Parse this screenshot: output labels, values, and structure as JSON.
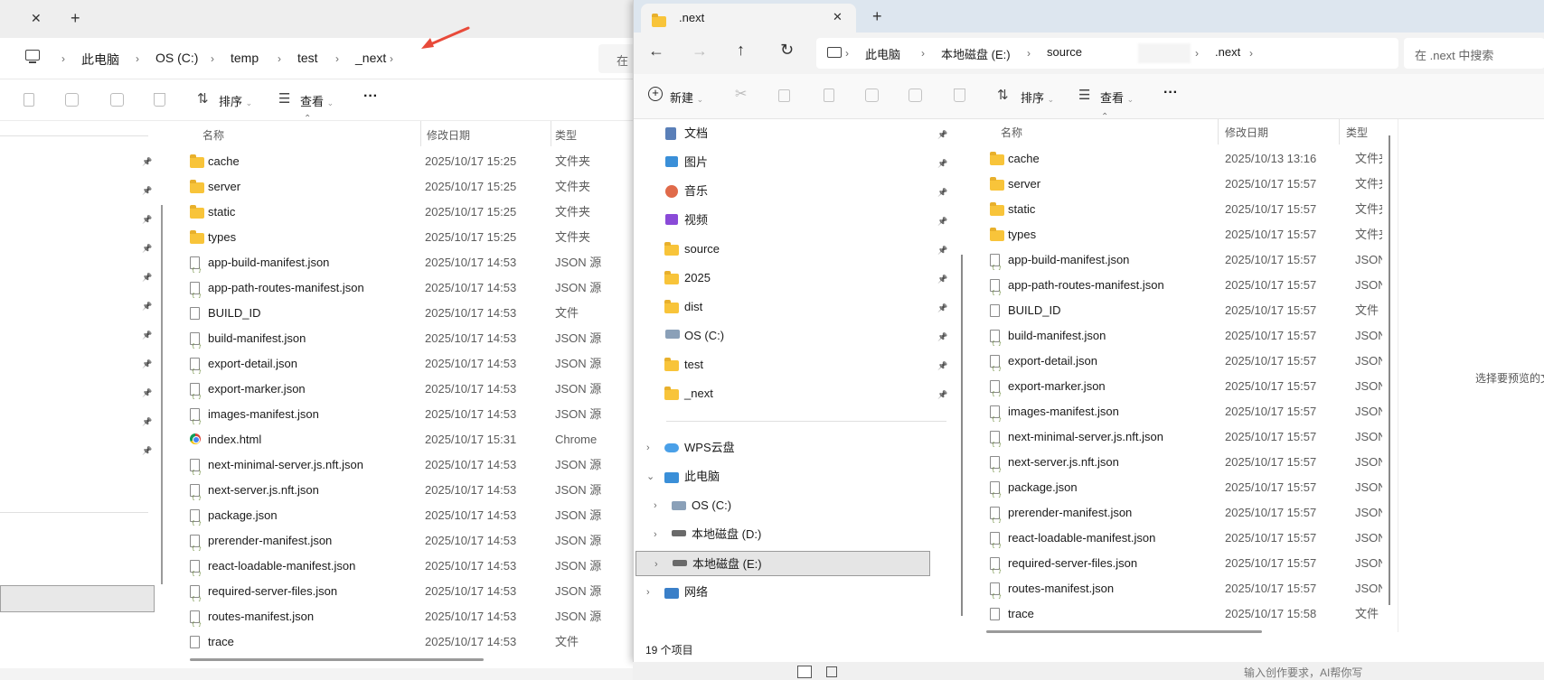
{
  "left_window": {
    "tab_close": "✕",
    "tab_new": "+",
    "breadcrumb": [
      "此电脑",
      "OS (C:)",
      "temp",
      "test",
      "_next"
    ],
    "search_partial": "在",
    "toolbar": {
      "sort": "排序",
      "view": "查看",
      "more": "···"
    },
    "headers": {
      "name": "名称",
      "date": "修改日期",
      "type": "类型"
    },
    "files": [
      {
        "name": "cache",
        "date": "2025/10/17 15:25",
        "type": "文件夹",
        "kind": "folder"
      },
      {
        "name": "server",
        "date": "2025/10/17 15:25",
        "type": "文件夹",
        "kind": "folder"
      },
      {
        "name": "static",
        "date": "2025/10/17 15:25",
        "type": "文件夹",
        "kind": "folder"
      },
      {
        "name": "types",
        "date": "2025/10/17 15:25",
        "type": "文件夹",
        "kind": "folder"
      },
      {
        "name": "app-build-manifest.json",
        "date": "2025/10/17 14:53",
        "type": "JSON 源",
        "kind": "json"
      },
      {
        "name": "app-path-routes-manifest.json",
        "date": "2025/10/17 14:53",
        "type": "JSON 源",
        "kind": "json"
      },
      {
        "name": "BUILD_ID",
        "date": "2025/10/17 14:53",
        "type": "文件",
        "kind": "file"
      },
      {
        "name": "build-manifest.json",
        "date": "2025/10/17 14:53",
        "type": "JSON 源",
        "kind": "json"
      },
      {
        "name": "export-detail.json",
        "date": "2025/10/17 14:53",
        "type": "JSON 源",
        "kind": "json"
      },
      {
        "name": "export-marker.json",
        "date": "2025/10/17 14:53",
        "type": "JSON 源",
        "kind": "json"
      },
      {
        "name": "images-manifest.json",
        "date": "2025/10/17 14:53",
        "type": "JSON 源",
        "kind": "json"
      },
      {
        "name": "index.html",
        "date": "2025/10/17 15:31",
        "type": "Chrome",
        "kind": "chrome"
      },
      {
        "name": "next-minimal-server.js.nft.json",
        "date": "2025/10/17 14:53",
        "type": "JSON 源",
        "kind": "json"
      },
      {
        "name": "next-server.js.nft.json",
        "date": "2025/10/17 14:53",
        "type": "JSON 源",
        "kind": "json"
      },
      {
        "name": "package.json",
        "date": "2025/10/17 14:53",
        "type": "JSON 源",
        "kind": "json"
      },
      {
        "name": "prerender-manifest.json",
        "date": "2025/10/17 14:53",
        "type": "JSON 源",
        "kind": "json"
      },
      {
        "name": "react-loadable-manifest.json",
        "date": "2025/10/17 14:53",
        "type": "JSON 源",
        "kind": "json"
      },
      {
        "name": "required-server-files.json",
        "date": "2025/10/17 14:53",
        "type": "JSON 源",
        "kind": "json"
      },
      {
        "name": "routes-manifest.json",
        "date": "2025/10/17 14:53",
        "type": "JSON 源",
        "kind": "json"
      },
      {
        "name": "trace",
        "date": "2025/10/17 14:53",
        "type": "文件",
        "kind": "file"
      }
    ]
  },
  "right_window": {
    "tab_title": ".next",
    "tab_close": "✕",
    "tab_new": "+",
    "breadcrumb": [
      "此电脑",
      "本地磁盘 (E:)",
      "source",
      ".next"
    ],
    "search_placeholder": "在 .next 中搜索",
    "toolbar": {
      "new": "新建",
      "sort": "排序",
      "view": "查看",
      "more": "···"
    },
    "quick_access": [
      {
        "label": "文档",
        "icon": "documents-icon"
      },
      {
        "label": "图片",
        "icon": "pictures-icon"
      },
      {
        "label": "音乐",
        "icon": "music-icon"
      },
      {
        "label": "视频",
        "icon": "video-icon"
      },
      {
        "label": "source",
        "icon": "folder-icon"
      },
      {
        "label": "2025",
        "icon": "folder-icon"
      },
      {
        "label": "dist",
        "icon": "folder-icon"
      },
      {
        "label": "OS (C:)",
        "icon": "os-drive-icon"
      },
      {
        "label": "test",
        "icon": "folder-icon"
      },
      {
        "label": "_next",
        "icon": "folder-icon"
      }
    ],
    "tree": [
      {
        "label": "WPS云盘",
        "icon": "cloud-icon",
        "indent": 0,
        "expanded": false
      },
      {
        "label": "此电脑",
        "icon": "pc-icon",
        "indent": 0,
        "expanded": true
      },
      {
        "label": "OS (C:)",
        "icon": "os-drive-icon",
        "indent": 1,
        "expanded": false
      },
      {
        "label": "本地磁盘 (D:)",
        "icon": "drive-icon",
        "indent": 1,
        "expanded": false
      },
      {
        "label": "本地磁盘 (E:)",
        "icon": "drive-icon",
        "indent": 1,
        "expanded": false,
        "selected": true
      },
      {
        "label": "网络",
        "icon": "network-icon",
        "indent": 0,
        "expanded": false
      }
    ],
    "headers": {
      "name": "名称",
      "date": "修改日期",
      "type": "类型"
    },
    "files": [
      {
        "name": "cache",
        "date": "2025/10/13 13:16",
        "type": "文件夹",
        "kind": "folder"
      },
      {
        "name": "server",
        "date": "2025/10/17 15:57",
        "type": "文件夹",
        "kind": "folder"
      },
      {
        "name": "static",
        "date": "2025/10/17 15:57",
        "type": "文件夹",
        "kind": "folder"
      },
      {
        "name": "types",
        "date": "2025/10/17 15:57",
        "type": "文件夹",
        "kind": "folder"
      },
      {
        "name": "app-build-manifest.json",
        "date": "2025/10/17 15:57",
        "type": "JSON",
        "kind": "json"
      },
      {
        "name": "app-path-routes-manifest.json",
        "date": "2025/10/17 15:57",
        "type": "JSON",
        "kind": "json"
      },
      {
        "name": "BUILD_ID",
        "date": "2025/10/17 15:57",
        "type": "文件",
        "kind": "file"
      },
      {
        "name": "build-manifest.json",
        "date": "2025/10/17 15:57",
        "type": "JSON",
        "kind": "json"
      },
      {
        "name": "export-detail.json",
        "date": "2025/10/17 15:57",
        "type": "JSON",
        "kind": "json"
      },
      {
        "name": "export-marker.json",
        "date": "2025/10/17 15:57",
        "type": "JSON",
        "kind": "json"
      },
      {
        "name": "images-manifest.json",
        "date": "2025/10/17 15:57",
        "type": "JSON",
        "kind": "json"
      },
      {
        "name": "next-minimal-server.js.nft.json",
        "date": "2025/10/17 15:57",
        "type": "JSON",
        "kind": "json"
      },
      {
        "name": "next-server.js.nft.json",
        "date": "2025/10/17 15:57",
        "type": "JSON",
        "kind": "json"
      },
      {
        "name": "package.json",
        "date": "2025/10/17 15:57",
        "type": "JSON",
        "kind": "json"
      },
      {
        "name": "prerender-manifest.json",
        "date": "2025/10/17 15:57",
        "type": "JSON",
        "kind": "json"
      },
      {
        "name": "react-loadable-manifest.json",
        "date": "2025/10/17 15:57",
        "type": "JSON",
        "kind": "json"
      },
      {
        "name": "required-server-files.json",
        "date": "2025/10/17 15:57",
        "type": "JSON",
        "kind": "json"
      },
      {
        "name": "routes-manifest.json",
        "date": "2025/10/17 15:57",
        "type": "JSON",
        "kind": "json"
      },
      {
        "name": "trace",
        "date": "2025/10/17 15:58",
        "type": "文件",
        "kind": "file"
      }
    ],
    "status_count": "19 个项目",
    "preview_hint": "选择要预览的文"
  },
  "background": {
    "ai_prompt": "输入创作要求，AI帮你写"
  },
  "colors": {
    "accent": "#0067c0",
    "arrow": "#e84a3a",
    "folder": "#f8c43a",
    "selected": "#e5e5e5"
  }
}
